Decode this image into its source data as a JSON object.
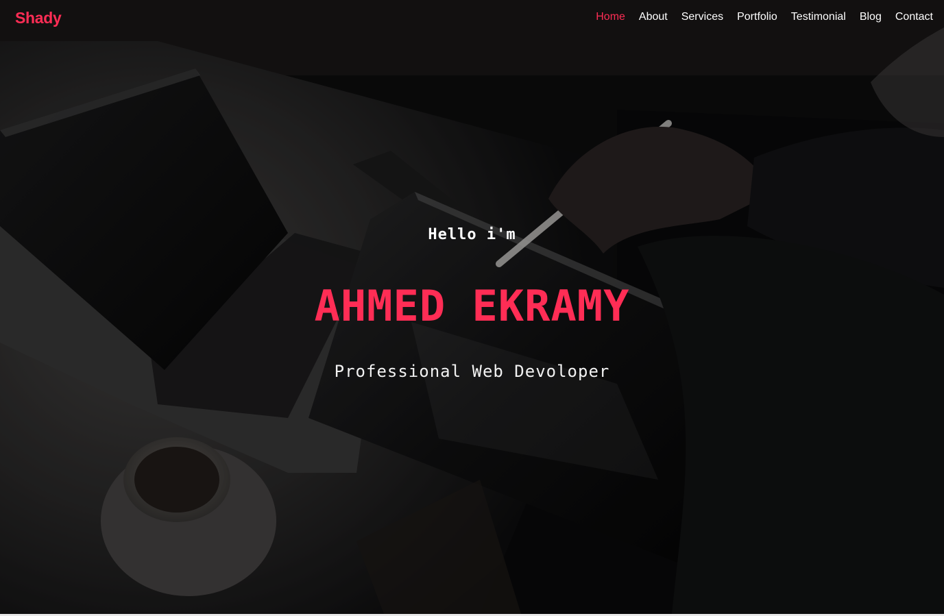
{
  "colors": {
    "accent": "#ff2d55",
    "nav_text": "#ffffff",
    "background": "#0b0b0c"
  },
  "navbar": {
    "brand": "Shady",
    "links": [
      {
        "label": "Home",
        "active": true
      },
      {
        "label": "About",
        "active": false
      },
      {
        "label": "Services",
        "active": false
      },
      {
        "label": "Portfolio",
        "active": false
      },
      {
        "label": "Testimonial",
        "active": false
      },
      {
        "label": "Blog",
        "active": false
      },
      {
        "label": "Contact",
        "active": false
      }
    ]
  },
  "hero": {
    "greeting": "Hello i'm",
    "name": "AHMED EKRAMY",
    "role": "Professional Web Devoloper",
    "background_image": "dark desk scene with laptop, phone, tablet with stylus, and coffee cup"
  }
}
